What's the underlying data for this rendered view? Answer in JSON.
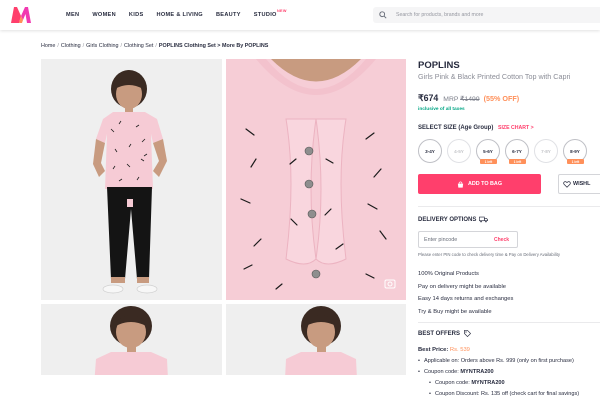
{
  "header": {
    "nav": [
      {
        "label": "MEN"
      },
      {
        "label": "WOMEN"
      },
      {
        "label": "KIDS"
      },
      {
        "label": "HOME & LIVING"
      },
      {
        "label": "BEAUTY"
      },
      {
        "label": "STUDIO",
        "badge": "NEW"
      }
    ],
    "search_placeholder": "Search for products, brands and more"
  },
  "breadcrumb": {
    "items": [
      "Home",
      "Clothing",
      "Girls Clothing",
      "Clothing Set"
    ],
    "current": "POPLINS Clothing Set > More By POPLINS"
  },
  "product": {
    "brand": "POPLINS",
    "name": "Girls Pink & Black Printed Cotton Top with Capri",
    "price": "₹674",
    "mrp_label": "MRP",
    "mrp": "₹1499",
    "discount": "(55% OFF)",
    "tax_note": "inclusive of all taxes"
  },
  "sizes": {
    "heading": "SELECT SIZE (Age Group)",
    "chart_label": "SIZE CHART >",
    "options": [
      {
        "label": "3-4Y",
        "available": true,
        "left": ""
      },
      {
        "label": "4-5Y",
        "available": false,
        "left": ""
      },
      {
        "label": "5-6Y",
        "available": true,
        "left": "1 left"
      },
      {
        "label": "6-7Y",
        "available": true,
        "left": "1 left"
      },
      {
        "label": "7-8Y",
        "available": false,
        "left": ""
      },
      {
        "label": "8-9Y",
        "available": true,
        "left": "1 left"
      }
    ]
  },
  "actions": {
    "add_to_bag": "ADD TO BAG",
    "wishlist": "WISHL"
  },
  "delivery": {
    "heading": "DELIVERY OPTIONS",
    "pin_placeholder": "Enter pincode",
    "check": "Check",
    "note": "Please enter PIN code to check delivery time & Pay on Delivery Availability",
    "features": [
      "100% Original Products",
      "Pay on delivery might be available",
      "Easy 14 days returns and exchanges",
      "Try & Buy might be available"
    ]
  },
  "offers": {
    "heading": "BEST OFFERS",
    "best_price_label": "Best Price:",
    "best_price": "Rs. 539",
    "lines": [
      {
        "text": "Applicable on: Orders above Rs. 999 (only on first purchase)",
        "sub": false
      },
      {
        "prefix": "Coupon code: ",
        "code": "MYNTRA200",
        "sub": false
      },
      {
        "prefix": "Coupon code: ",
        "code": "MYNTRA200",
        "sub": true
      },
      {
        "text": "Coupon Discount: Rs. 135 off (check cart for final savings)",
        "sub": true
      }
    ]
  },
  "colors": {
    "brand_pink": "#ff3f6c",
    "discount_orange": "#ff905a",
    "tax_green": "#03a685",
    "top_pink": "#f6cdd6"
  },
  "icons": [
    "myntra-logo",
    "search-icon",
    "bag-icon",
    "heart-icon",
    "truck-icon",
    "tag-icon",
    "zoom-icon"
  ]
}
